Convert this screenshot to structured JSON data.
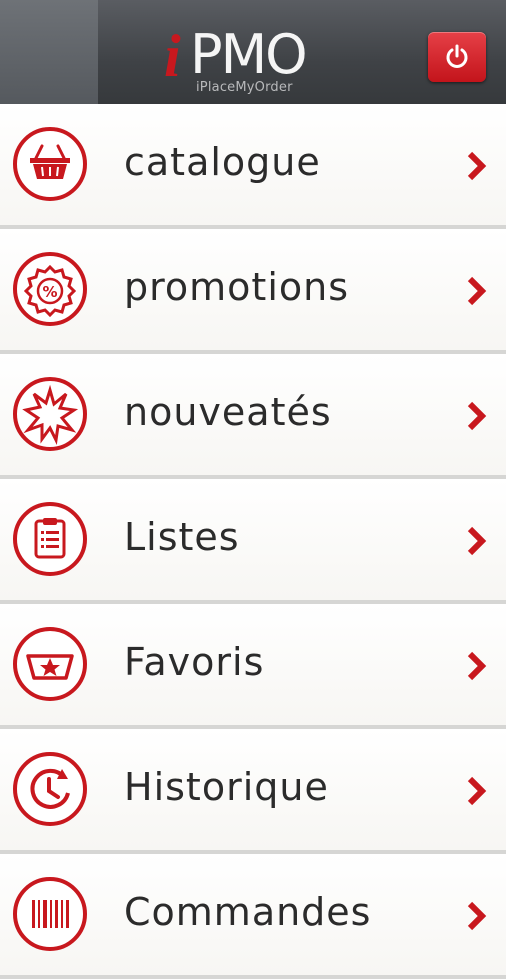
{
  "header": {
    "logo_i": "i",
    "logo_main": "PMO",
    "logo_subtitle": "iPlaceMyOrder",
    "power_icon": "power-icon"
  },
  "menu": {
    "items": [
      {
        "label": "catalogue",
        "icon": "basket-icon"
      },
      {
        "label": "promotions",
        "icon": "percent-badge-icon"
      },
      {
        "label": "nouveatés",
        "icon": "starburst-icon"
      },
      {
        "label": "Listes",
        "icon": "clipboard-icon"
      },
      {
        "label": "Favoris",
        "icon": "star-basket-icon"
      },
      {
        "label": "Historique",
        "icon": "history-clock-icon"
      },
      {
        "label": "Commandes",
        "icon": "barcode-icon"
      }
    ]
  },
  "colors": {
    "accent": "#c8181e",
    "header_bg": "#3f4246",
    "text": "#2b2b2b"
  }
}
